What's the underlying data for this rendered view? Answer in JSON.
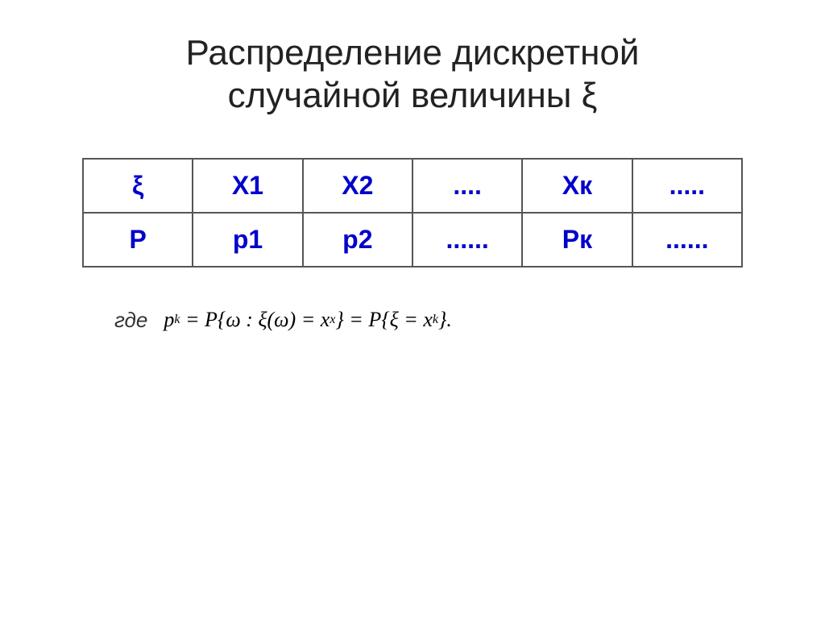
{
  "page": {
    "title_line1": "Распределение дискретной",
    "title_line2": "случайной величины ξ"
  },
  "table": {
    "row1": {
      "col1": "ξ",
      "col2": "X1",
      "col3": "X2",
      "col4": "....",
      "col5": "Хк",
      "col6": "....."
    },
    "row2": {
      "col1": "Р",
      "col2": "р1",
      "col3": "р2",
      "col4": "......",
      "col5": "Рк",
      "col6": "......"
    }
  },
  "formula": {
    "where_label": "где",
    "expression": "p_k = P{ω : ξ(ω) = x_x} = P{ξ = x_k}."
  }
}
